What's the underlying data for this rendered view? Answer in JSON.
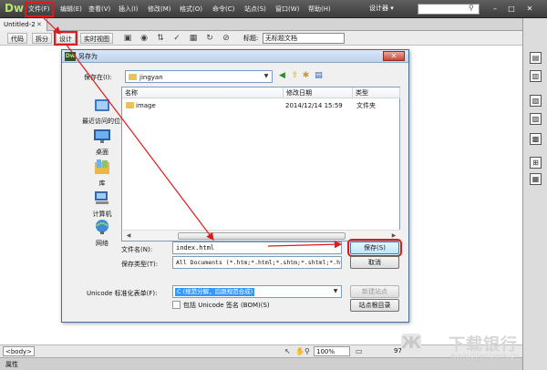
{
  "app": {
    "logo": "Dw",
    "menu": [
      "文件(F)",
      "编辑(E)",
      "查看(V)",
      "插入(I)",
      "修改(M)",
      "格式(O)",
      "命令(C)",
      "站点(S)",
      "窗口(W)",
      "帮助(H)"
    ],
    "workspace": "设计器 ▾",
    "doc_tab": "Untitled-2",
    "view_buttons": [
      "代码",
      "拆分",
      "设计",
      "实时视图"
    ],
    "title_label": "标题:",
    "title_value": "无标题文档",
    "body_tag": "<body>",
    "zoom": "100%",
    "status_size": "972",
    "prop_label": "属性"
  },
  "dialog": {
    "title": "另存为",
    "save_in_label": "保存在(I):",
    "save_in_value": "jingyan",
    "places": [
      "最近访问的位置",
      "桌面",
      "库",
      "计算机",
      "网络"
    ],
    "columns": [
      "名称",
      "修改日期",
      "类型"
    ],
    "files": [
      {
        "name": "image",
        "date": "2014/12/14 15:59",
        "type": "文件夹"
      }
    ],
    "filename_label": "文件名(N):",
    "filename_value": "index.html",
    "filetype_label": "保存类型(T):",
    "filetype_value": "All Documents (*.htm;*.html;*.shtm;*.shtml;*.hta;",
    "save_button": "保存(S)",
    "cancel_button": "取消",
    "unicode_label": "Unicode 标准化表单(F):",
    "unicode_value": "C (规范分解，后跟规范合成)",
    "bom_label": "包括 Unicode 签名 (BOM)(S)",
    "new_site_button": "新建站点",
    "site_root_button": "站点根目录"
  },
  "watermark": {
    "title": "下载银行",
    "url": "www.downbank.cn"
  },
  "colors": {
    "highlight": "#e01a1a",
    "menubar": "#4a4a4a",
    "dialog_title": "#c9dcf2",
    "primary_button": "#bee6fd"
  },
  "icons": [
    "search-icon",
    "folder-icon",
    "up-folder-icon",
    "new-folder-icon",
    "views-icon",
    "close-icon",
    "desktop-icon",
    "library-icon",
    "computer-icon",
    "network-icon",
    "recent-icon"
  ]
}
